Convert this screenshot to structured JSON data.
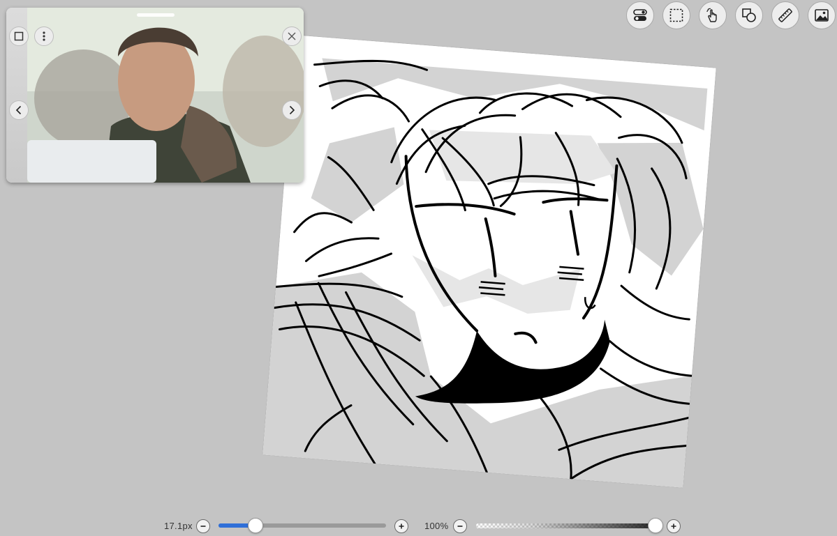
{
  "toolbar": {
    "tools": [
      {
        "name": "layer-toggle",
        "icon": "toggle-switch-icon"
      },
      {
        "name": "selection",
        "icon": "dashed-select-icon"
      },
      {
        "name": "gesture",
        "icon": "hand-icon"
      },
      {
        "name": "shapes",
        "icon": "shapes-icon"
      },
      {
        "name": "ruler",
        "icon": "ruler-icon"
      },
      {
        "name": "reference-image",
        "icon": "image-icon"
      }
    ]
  },
  "reference_window": {
    "prev_label": "<",
    "next_label": ">",
    "icons": [
      "square-icon",
      "more-vertical-icon",
      "close-icon",
      "chevron-left-icon",
      "chevron-right-icon"
    ]
  },
  "brush": {
    "size_label": "17.1px",
    "size_level": 0.22
  },
  "opacity": {
    "label": "100%",
    "level": 1.0
  },
  "colors": {
    "background": "#c4c4c4",
    "accent": "#2f6fd8",
    "canvas": "#ffffff",
    "ink": "#000000"
  }
}
